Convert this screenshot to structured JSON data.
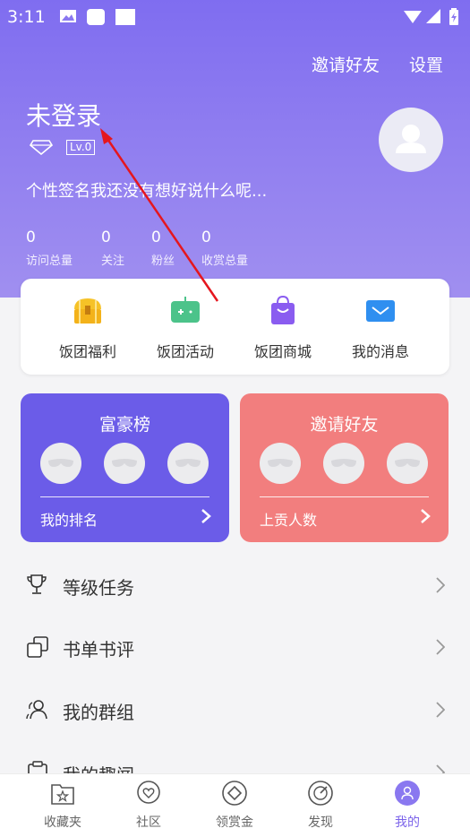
{
  "status_bar": {
    "time": "3:11"
  },
  "header": {
    "invite_label": "邀请好友",
    "settings_label": "设置"
  },
  "profile": {
    "username": "未登录",
    "level": "Lv.0",
    "signature": "个性签名我还没有想好说什么呢...",
    "stats": [
      {
        "value": "0",
        "label": "访问总量"
      },
      {
        "value": "0",
        "label": "关注"
      },
      {
        "value": "0",
        "label": "粉丝"
      },
      {
        "value": "0",
        "label": "收赏总量"
      }
    ]
  },
  "quick_actions": [
    {
      "label": "饭团福利",
      "icon": "treasure-chest-icon"
    },
    {
      "label": "饭团活动",
      "icon": "game-controller-icon"
    },
    {
      "label": "饭团商城",
      "icon": "shopping-bag-icon"
    },
    {
      "label": "我的消息",
      "icon": "mail-icon"
    }
  ],
  "cards": {
    "rich_list": {
      "title": "富豪榜",
      "footer": "我的排名",
      "color": "#6b5ce8"
    },
    "invite": {
      "title": "邀请好友",
      "footer": "上贡人数",
      "color": "#f27e7e"
    }
  },
  "menu": [
    {
      "label": "等级任务",
      "icon": "trophy-icon"
    },
    {
      "label": "书单书评",
      "icon": "booklist-icon"
    },
    {
      "label": "我的群组",
      "icon": "group-icon"
    },
    {
      "label": "我的趣闻",
      "icon": "clipboard-icon"
    }
  ],
  "tabs": [
    {
      "label": "收藏夹",
      "icon": "favorites-icon"
    },
    {
      "label": "社区",
      "icon": "community-icon"
    },
    {
      "label": "领赏金",
      "icon": "reward-icon"
    },
    {
      "label": "发现",
      "icon": "discover-icon"
    },
    {
      "label": "我的",
      "icon": "profile-icon",
      "active": true
    }
  ],
  "colors": {
    "accent": "#7b63ea",
    "hero_top": "#7f6df0",
    "invite_card": "#f27e7e",
    "rank_card": "#6b5ce8"
  }
}
